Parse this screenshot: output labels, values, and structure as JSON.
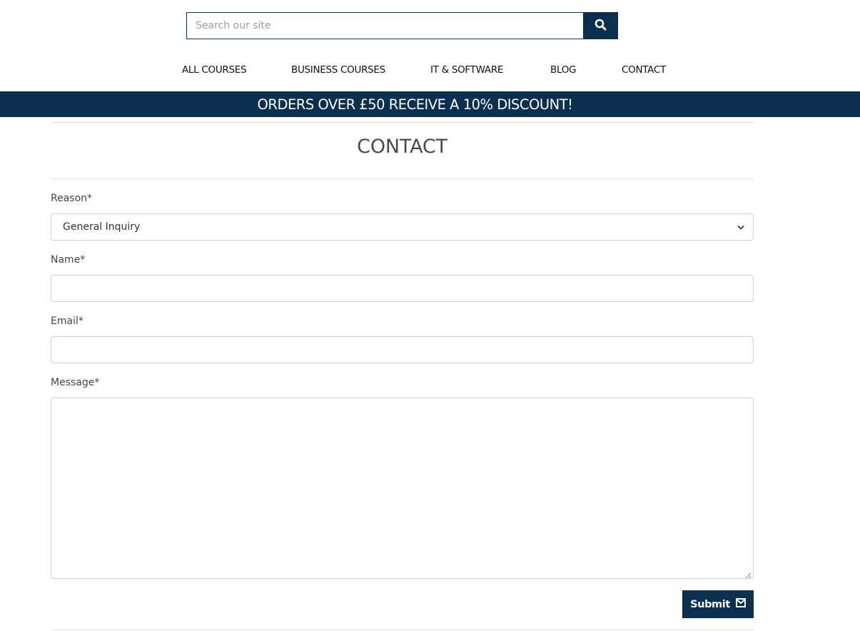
{
  "search": {
    "placeholder": "Search our site",
    "button_icon": "search-icon"
  },
  "nav": {
    "items": [
      {
        "label": "ALL COURSES"
      },
      {
        "label": "BUSINESS COURSES"
      },
      {
        "label": "IT & SOFTWARE"
      },
      {
        "label": "BLOG"
      },
      {
        "label": "CONTACT"
      }
    ]
  },
  "promo": {
    "text": "ORDERS OVER £50 RECEIVE A 10% DISCOUNT!"
  },
  "page": {
    "title": "CONTACT"
  },
  "form": {
    "reason": {
      "label": "Reason*",
      "value": "General Inquiry"
    },
    "name": {
      "label": "Name*",
      "value": ""
    },
    "email": {
      "label": "Email*",
      "value": ""
    },
    "message": {
      "label": "Message*",
      "value": ""
    },
    "submit": {
      "label": "Submit",
      "icon": "envelope-icon"
    }
  },
  "colors": {
    "brand": "#0b2f4e",
    "text": "#222222",
    "border": "#cdd2d6"
  }
}
